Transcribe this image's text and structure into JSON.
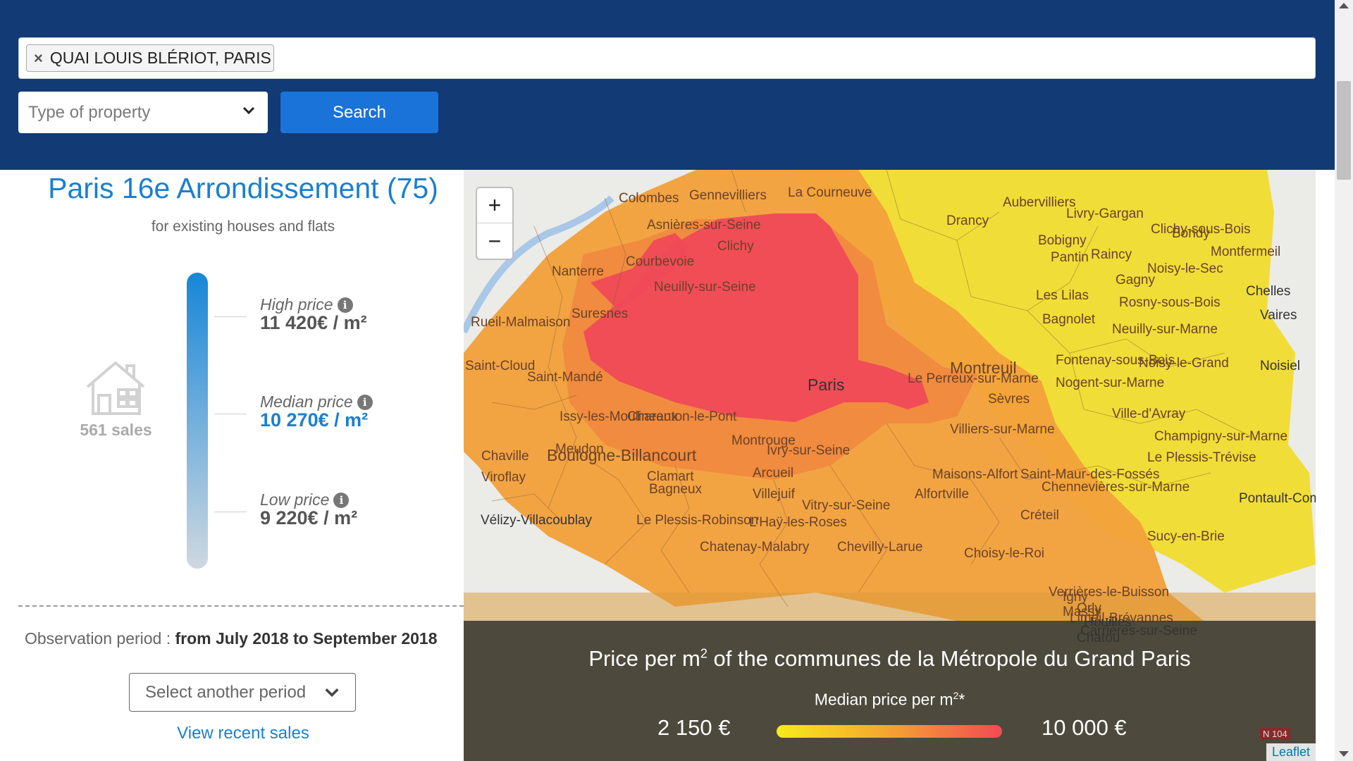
{
  "header": {
    "search_tag": "QUAI LOUIS BLÉRIOT, PARIS",
    "property_type_placeholder": "Type of property",
    "search_button": "Search"
  },
  "summary": {
    "title": "Paris 16e Arrondissement (75)",
    "subtitle": "for existing houses and flats",
    "sales": "561 sales",
    "high_label": "High price",
    "high_value": "11 420€ / m²",
    "median_label": "Median price",
    "median_value": "10 270€ / m²",
    "low_label": "Low price",
    "low_value": "9 220€ / m²",
    "observation_prefix": "Observation period :",
    "observation_period": "from July 2018 to September 2018",
    "period_select": "Select another period",
    "recent_sales_link": "View recent sales"
  },
  "map": {
    "zoom_in": "+",
    "zoom_out": "−",
    "overlay_title_pre": "Price per m",
    "overlay_title_sup": "2",
    "overlay_title_post": " of the communes de la Métropole du Grand Paris",
    "legend_title_pre": "Median price per m",
    "legend_title_sup": "2",
    "legend_title_post": "*",
    "legend_min": "2 150 €",
    "legend_max": "10 000 €",
    "attribution": "Leaflet",
    "road_badge": "N 104",
    "colors": {
      "low": "#f5ec1a",
      "mid": "#f5a331",
      "high": "#f14a55"
    },
    "labels": [
      {
        "text": "Paris",
        "cls": "dark big"
      },
      {
        "text": "Boulogne-Billancourt",
        "cls": "big"
      },
      {
        "text": "Montreuil",
        "cls": "big"
      },
      {
        "text": "Colombes",
        "cls": ""
      },
      {
        "text": "Gennevilliers",
        "cls": ""
      },
      {
        "text": "La Courneuve",
        "cls": ""
      },
      {
        "text": "Aubervilliers",
        "cls": ""
      },
      {
        "text": "Drancy",
        "cls": ""
      },
      {
        "text": "Bobigny",
        "cls": ""
      },
      {
        "text": "Bondy",
        "cls": ""
      },
      {
        "text": "Livry-Gargan",
        "cls": ""
      },
      {
        "text": "Clichy-sous-Bois",
        "cls": ""
      },
      {
        "text": "Montfermeil",
        "cls": ""
      },
      {
        "text": "Asnières-sur-Seine",
        "cls": ""
      },
      {
        "text": "Clichy",
        "cls": ""
      },
      {
        "text": "Pantin",
        "cls": ""
      },
      {
        "text": "Nanterre",
        "cls": ""
      },
      {
        "text": "Courbevoie",
        "cls": ""
      },
      {
        "text": "Neuilly-sur-Seine",
        "cls": ""
      },
      {
        "text": "Noisy-le-Sec",
        "cls": ""
      },
      {
        "text": "Raincy",
        "cls": ""
      },
      {
        "text": "Gagny",
        "cls": ""
      },
      {
        "text": "Les Lilas",
        "cls": ""
      },
      {
        "text": "Rosny-sous-Bois",
        "cls": ""
      },
      {
        "text": "Bagnolet",
        "cls": ""
      },
      {
        "text": "Neuilly-sur-Marne",
        "cls": ""
      },
      {
        "text": "Rueil-Malmaison",
        "cls": ""
      },
      {
        "text": "Suresnes",
        "cls": ""
      },
      {
        "text": "Fontenay-sous-Bois",
        "cls": ""
      },
      {
        "text": "Noisy-le-Grand",
        "cls": ""
      },
      {
        "text": "Saint-Cloud",
        "cls": ""
      },
      {
        "text": "Saint-Mandé",
        "cls": ""
      },
      {
        "text": "Le Perreux-sur-Marne",
        "cls": ""
      },
      {
        "text": "Nogent-sur-Marne",
        "cls": ""
      },
      {
        "text": "Sèvres",
        "cls": ""
      },
      {
        "text": "Issy-les-Moulineaux",
        "cls": ""
      },
      {
        "text": "Charenton-le-Pont",
        "cls": ""
      },
      {
        "text": "Villiers-sur-Marne",
        "cls": ""
      },
      {
        "text": "Ville-d'Avray",
        "cls": ""
      },
      {
        "text": "Champigny-sur-Marne",
        "cls": ""
      },
      {
        "text": "Meudon",
        "cls": ""
      },
      {
        "text": "Montrouge",
        "cls": ""
      },
      {
        "text": "Ivry-sur-Seine",
        "cls": ""
      },
      {
        "text": "Chaville",
        "cls": ""
      },
      {
        "text": "Le Plessis-Trévise",
        "cls": ""
      },
      {
        "text": "Viroflay",
        "cls": ""
      },
      {
        "text": "Clamart",
        "cls": ""
      },
      {
        "text": "Arcueil",
        "cls": ""
      },
      {
        "text": "Maisons-Alfort",
        "cls": ""
      },
      {
        "text": "Saint-Maur-des-Fossés",
        "cls": ""
      },
      {
        "text": "Chennevières-sur-Marne",
        "cls": ""
      },
      {
        "text": "Bagneux",
        "cls": ""
      },
      {
        "text": "Villejuif",
        "cls": ""
      },
      {
        "text": "Alfortville",
        "cls": ""
      },
      {
        "text": "Vitry-sur-Seine",
        "cls": ""
      },
      {
        "text": "Créteil",
        "cls": ""
      },
      {
        "text": "Vélizy-Villacoublay",
        "cls": "dark"
      },
      {
        "text": "Le Plessis-Robinson",
        "cls": ""
      },
      {
        "text": "L'Haÿ-les-Roses",
        "cls": ""
      },
      {
        "text": "Pontault-Combault",
        "cls": "dark"
      },
      {
        "text": "Chelles",
        "cls": "dark"
      },
      {
        "text": "Vaires",
        "cls": "dark"
      },
      {
        "text": "Noisiel",
        "cls": "dark"
      },
      {
        "text": "Sucy-en-Brie",
        "cls": ""
      },
      {
        "text": "Chatenay-Malabry",
        "cls": ""
      },
      {
        "text": "Chevilly-Larue",
        "cls": ""
      },
      {
        "text": "Choisy-le-Roi",
        "cls": ""
      },
      {
        "text": "Verrières-le-Buisson",
        "cls": ""
      },
      {
        "text": "Igny",
        "cls": ""
      },
      {
        "text": "Massy",
        "cls": ""
      },
      {
        "text": "Orly",
        "cls": ""
      },
      {
        "text": "Limeil-Brévannes",
        "cls": ""
      },
      {
        "text": "Houilles",
        "cls": "dark"
      },
      {
        "text": "Carrières-sur-Seine",
        "cls": "dark"
      },
      {
        "text": "Chatou",
        "cls": "dark"
      }
    ]
  }
}
